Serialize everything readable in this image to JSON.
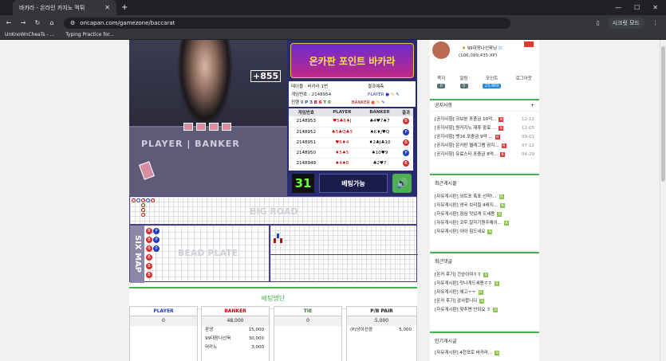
{
  "browser": {
    "tab_title": "바카라 - 온라인 카지노 먹튀",
    "url": "oncapan.com/gamezone/baccarat",
    "guest_mode": "시크릿 모드",
    "bookmarks": [
      "UnKnoWnCheaTs - ...",
      "Typing Practice for..."
    ]
  },
  "game": {
    "live_badge": "+855",
    "table_labels": [
      "PLAYER",
      "BANKER"
    ],
    "banner": "온카판 포인트 바카라",
    "info": {
      "table_label": "테이블 : 바카라 1번",
      "result_label": "결과예측",
      "round_label": "게임번호 : 2148954",
      "progress": "진행 9",
      "p": "P 3",
      "b": "B 6",
      "t": "T 0",
      "player": "PLAYER",
      "banker": "BANKER"
    },
    "results_table": {
      "headers": [
        "게임번호",
        "PLAYER",
        "BANKER",
        "결과"
      ],
      "rows": [
        {
          "id": "2148953",
          "player": "♥5♣6♦J",
          "banker": "♣4♥7♠7",
          "result": "B",
          "color": "#d32f2f"
        },
        {
          "id": "2148952",
          "player": "♣5♣Q♣3",
          "banker": "♠K♦J♥Q",
          "result": "P",
          "color": "#1e3fc8"
        },
        {
          "id": "2148951",
          "player": "♥6♦4",
          "banker": "♦2♣J♣10",
          "result": "B",
          "color": "#d32f2f"
        },
        {
          "id": "2148950",
          "player": "♦5♠5",
          "banker": "♠10♥9",
          "result": "P",
          "color": "#1e3fc8"
        },
        {
          "id": "2148949",
          "player": "♠4♠8",
          "banker": "♣2♥7",
          "result": "B",
          "color": "#d32f2f"
        }
      ]
    },
    "timer": "31",
    "bet_status": "베팅가능",
    "big_road_label": "BIG ROAD",
    "six_map_label": "SIX MAP",
    "bead_plate_label": "BEAD PLATE",
    "six_map": [
      [
        "B",
        "P"
      ],
      [
        "B",
        "P"
      ],
      [
        "B",
        "P"
      ],
      [
        "B"
      ],
      [
        "B"
      ],
      [
        "B"
      ]
    ]
  },
  "betting": {
    "title": "베팅명단",
    "player": {
      "label": "PLAYER",
      "total": "0"
    },
    "banker": {
      "label": "BANKER",
      "total": "48,000",
      "bets": [
        {
          "name": "판생",
          "amount": "15,000"
        },
        {
          "name": "99대장나선욱",
          "amount": "30,000"
        },
        {
          "name": "머카노",
          "amount": "3,000"
        }
      ]
    },
    "tie": {
      "label": "TIE",
      "total": "0"
    },
    "pair": {
      "label": "P/B PAIR",
      "total": "5,000",
      "bets": [
        {
          "name": "(P)냥이선생",
          "amount": "5,000"
        }
      ]
    }
  },
  "sidebar": {
    "profile": {
      "name": "99대장나선욱님",
      "xp": "(106,099,435 XP)"
    },
    "stats": [
      {
        "label": "쪽지",
        "value": "0"
      },
      {
        "label": "알림",
        "value": "0"
      },
      {
        "label": "포인트",
        "value": "23,969"
      },
      {
        "label": "로그아웃",
        "value": ""
      }
    ],
    "notice": {
      "title": "공지사항",
      "items": [
        {
          "text": "[공지사항] 크보본 포충금 10억...",
          "date": "12-12"
        },
        {
          "text": "[공지사항] 원커지노 재휴 중료 ...",
          "date": "12-05"
        },
        {
          "text": "[공지사항] 벳16 포충금 9억 ...",
          "date": "09-01"
        },
        {
          "text": "[공지사항] 온카판 텔레그램 공지...",
          "date": "07-12"
        },
        {
          "text": "[공지사항] 유료스타 포충금 8억...",
          "date": "04-29"
        }
      ]
    },
    "recent_posts": {
      "title": "최근게시물",
      "items": [
        "[자유게시판] 와트포 폭포 선착!...",
        "[자유게시판] 영국 브리칠 4레지...",
        "[자유게시판] 점심 맛있게 드세용",
        "[자유게시판] 코우.갈자기원주예이...",
        "[자유게시판] 아아 힘드네요"
      ]
    },
    "recent_comments": {
      "title": "최근댓글",
      "items": [
        "[온카 후기] 건승이여ㅎㅎ",
        "[자유게시판] 맛나게드세용ㅎㅎ",
        "[자유게시판] 에고ㅜㅜ",
        "[온카 후기] 감사합니다",
        "[자유게시판] 맞추면 안되요 ㅎ"
      ]
    },
    "popular": {
      "title": "인기게시글",
      "items": [
        "[자유게시판] 4천포로 바카라..."
      ]
    }
  }
}
